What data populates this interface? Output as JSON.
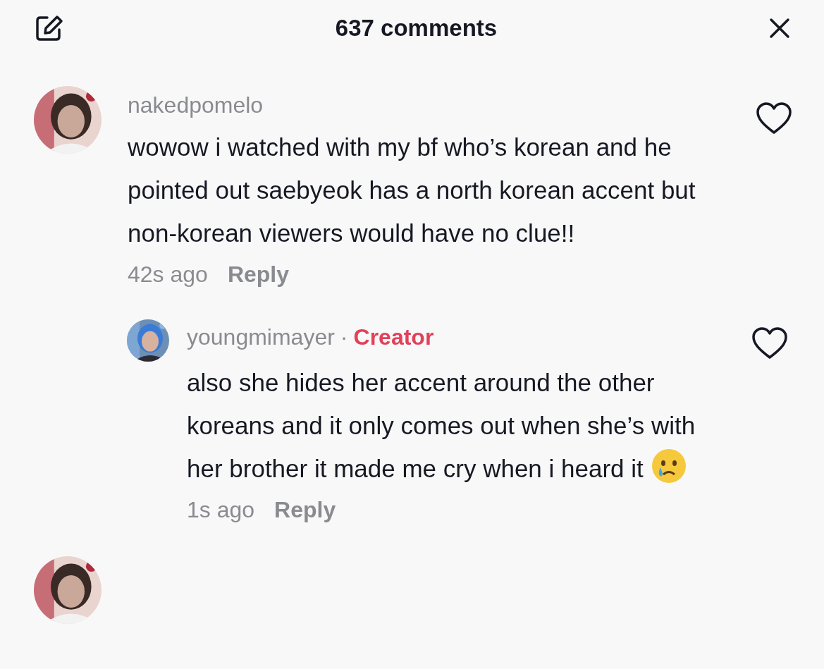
{
  "header": {
    "title": "637 comments"
  },
  "comments": [
    {
      "avatar": {
        "kind": "picture"
      },
      "username": "nakedpomelo",
      "text": "wowow i watched with my bf who’s korean and he pointed out saebyeok has a north korean accent but non-korean viewers would have no clue!!",
      "time": "42s ago",
      "reply_label": "Reply",
      "replies": [
        {
          "avatar": {
            "kind": "picture"
          },
          "username": "youngmimayer",
          "separator": "·",
          "badge": "Creator",
          "text": "also she hides her accent around the other koreans and it only comes out when she’s with her brother it made me cry when i heard it",
          "has_emoji": true,
          "time": "1s ago",
          "reply_label": "Reply"
        }
      ]
    },
    {
      "avatar": {
        "kind": "picture"
      }
    }
  ]
}
